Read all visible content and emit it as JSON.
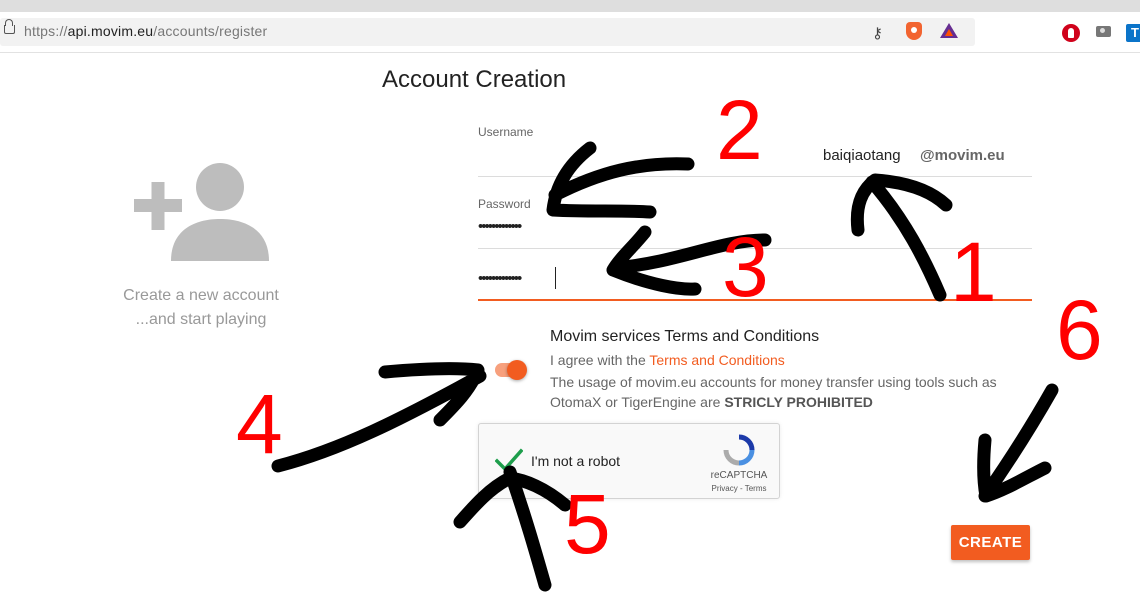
{
  "browser": {
    "url_scheme": "https://",
    "url_host": "api.movim.eu",
    "url_path": "/accounts/register"
  },
  "page": {
    "title": "Account Creation",
    "promo_line1": "Create a new account",
    "promo_line2": "...and start playing"
  },
  "form": {
    "username_label": "Username",
    "username_value": "baiqiaotang",
    "domain_suffix": "@movim.eu",
    "password_label": "Password",
    "password_value": "•••••••••••••",
    "password_confirm_value": "•••••••••••••"
  },
  "terms": {
    "title": "Movim services Terms and Conditions",
    "agree_prefix": "I agree with the ",
    "agree_link": "Terms and Conditions",
    "warning_text": "The usage of movim.eu accounts for money transfer using tools such as OtomaX or TigerEngine are ",
    "warning_bold": "STRICLY PROHIBITED",
    "toggle_on": true
  },
  "captcha": {
    "label": "I'm not a robot",
    "brand": "reCAPTCHA",
    "links": "Privacy - Terms",
    "checked": true
  },
  "actions": {
    "create_label": "CREATE"
  },
  "annotations": [
    "1",
    "2",
    "3",
    "4",
    "5",
    "6"
  ],
  "colors": {
    "accent": "#f25c20",
    "annotation": "#ff0000"
  }
}
